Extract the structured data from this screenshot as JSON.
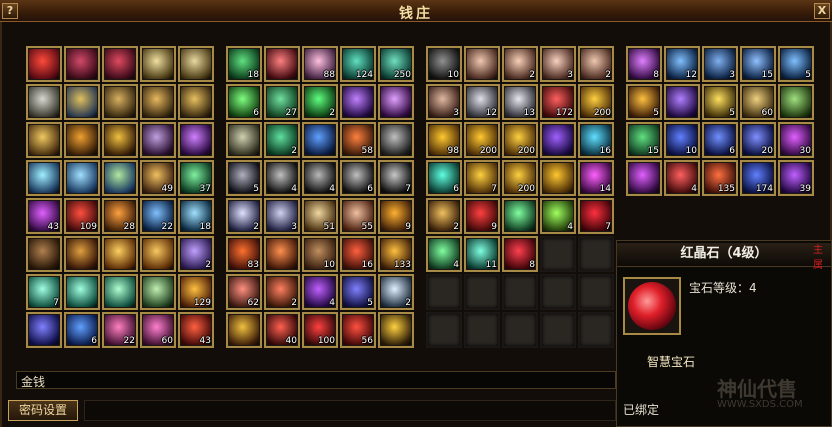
{
  "window": {
    "title": "钱庄",
    "help_label": "?",
    "close_label": "X"
  },
  "colors": {
    "frame_gold": "#a78a45",
    "title_text": "#f3dfa4",
    "gem_red": "#e0202a",
    "watermark_red": "#d02020"
  },
  "bags": [
    {
      "name": "bag-1",
      "slots": [
        {
          "icon": "red-feather-icon",
          "c1": "#ff4a3a",
          "c2": "#5a0a14"
        },
        {
          "icon": "crimson-wing-icon",
          "c1": "#d24a6a",
          "c2": "#3a0a18"
        },
        {
          "icon": "crimson-wing-icon",
          "c1": "#e04a60",
          "c2": "#3a0a18"
        },
        {
          "icon": "gold-ring-icon",
          "c1": "#f0e0a0",
          "c2": "#4a3a14"
        },
        {
          "icon": "gold-ring-icon",
          "c1": "#e8d8a0",
          "c2": "#4a3a14"
        },
        {
          "icon": "silver-ring-icon",
          "c1": "#d8d8d0",
          "c2": "#3a3a30"
        },
        {
          "icon": "armor-icon",
          "c1": "#e0c060",
          "c2": "#2a3a50"
        },
        {
          "icon": "armor-icon",
          "c1": "#d8b060",
          "c2": "#3a2a10"
        },
        {
          "icon": "armor-icon",
          "c1": "#e8b860",
          "c2": "#3a2a10"
        },
        {
          "icon": "armor-icon",
          "c1": "#e8c060",
          "c2": "#3a2a10"
        },
        {
          "icon": "gold-armor-icon",
          "c1": "#f0c860",
          "c2": "#4a3010"
        },
        {
          "icon": "gold-emblem-icon",
          "c1": "#f0a030",
          "c2": "#3a2008"
        },
        {
          "icon": "gold-bracelet-icon",
          "c1": "#f0c040",
          "c2": "#3a2008"
        },
        {
          "icon": "sword-icon",
          "c1": "#c0a0e0",
          "c2": "#2a1030"
        },
        {
          "icon": "purple-crystal-icon",
          "c1": "#d080ff",
          "c2": "#2a0a40"
        },
        {
          "icon": "spirit-icon",
          "c1": "#a0f0ff",
          "c2": "#1a3a60"
        },
        {
          "icon": "spirit-icon",
          "c1": "#a0e0ff",
          "c2": "#1a3a60"
        },
        {
          "icon": "spirit-icon",
          "c1": "#b0e8a0",
          "c2": "#1a3a60"
        },
        {
          "icon": "scroll-icon",
          "c1": "#f0c060",
          "c2": "#402410",
          "count": "49"
        },
        {
          "icon": "spirit-icon",
          "c1": "#80f0a0",
          "c2": "#0a3a20",
          "count": "37"
        },
        {
          "icon": "purple-seal-icon",
          "c1": "#e060ff",
          "c2": "#300a40",
          "count": "43"
        },
        {
          "icon": "red-seal-icon",
          "c1": "#ff5040",
          "c2": "#400a0a",
          "count": "109"
        },
        {
          "icon": "fire-seal-icon",
          "c1": "#ffa040",
          "c2": "#402008",
          "count": "28"
        },
        {
          "icon": "water-seal-icon",
          "c1": "#80c0ff",
          "c2": "#0a2040",
          "count": "22"
        },
        {
          "icon": "ice-seal-icon",
          "c1": "#a0e0ff",
          "c2": "#0a2a40",
          "count": "18"
        },
        {
          "icon": "brown-charm-icon",
          "c1": "#b08050",
          "c2": "#2a1808"
        },
        {
          "icon": "compass-icon",
          "c1": "#e0a040",
          "c2": "#3a1808"
        },
        {
          "icon": "gold-coin-icon",
          "c1": "#ffd060",
          "c2": "#603008"
        },
        {
          "icon": "gold-coin-icon",
          "c1": "#f8c860",
          "c2": "#603008"
        },
        {
          "icon": "jade-tablet-icon",
          "c1": "#c0a0ff",
          "c2": "#2a1a50",
          "count": "2"
        },
        {
          "icon": "jade-tablet-icon",
          "c1": "#a0ffe0",
          "c2": "#105040",
          "count": "7"
        },
        {
          "icon": "jade-tablet-icon",
          "c1": "#a0ffe0",
          "c2": "#105040"
        },
        {
          "icon": "jade-tablet-icon",
          "c1": "#b0ffd0",
          "c2": "#105040"
        },
        {
          "icon": "jade-tablet-icon",
          "c1": "#c0f0b0",
          "c2": "#204020"
        },
        {
          "icon": "fire-spell-icon",
          "c1": "#ffc040",
          "c2": "#502008",
          "count": "129"
        },
        {
          "icon": "blue-rune-icon",
          "c1": "#8080ff",
          "c2": "#10104a"
        },
        {
          "icon": "blue-rune-icon",
          "c1": "#60a0ff",
          "c2": "#0a1a4a",
          "count": "6"
        },
        {
          "icon": "jade-tablet-icon",
          "c1": "#ff80c0",
          "c2": "#401030",
          "count": "22"
        },
        {
          "icon": "jade-tablet-icon",
          "c1": "#ff80d0",
          "c2": "#401030",
          "count": "60"
        },
        {
          "icon": "flame-spell-icon",
          "c1": "#ff6040",
          "c2": "#400808",
          "count": "43"
        }
      ]
    },
    {
      "name": "bag-2",
      "slots": [
        {
          "icon": "green-jade-icon",
          "c1": "#60e080",
          "c2": "#0a3a1a",
          "count": "18"
        },
        {
          "icon": "red-crystal-icon",
          "c1": "#ff8080",
          "c2": "#400a10"
        },
        {
          "icon": "pink-gem-icon",
          "c1": "#ffc0e0",
          "c2": "#402040",
          "count": "88"
        },
        {
          "icon": "teal-relic-icon",
          "c1": "#60e0c0",
          "c2": "#0a3a30",
          "count": "124"
        },
        {
          "icon": "teal-relic-icon",
          "c1": "#70e0c0",
          "c2": "#0a3a30",
          "count": "250"
        },
        {
          "icon": "green-orb-icon",
          "c1": "#80ff80",
          "c2": "#104010",
          "count": "6"
        },
        {
          "icon": "green-orb-icon",
          "c1": "#70e0a0",
          "c2": "#104020",
          "count": "27"
        },
        {
          "icon": "green-shard-icon",
          "c1": "#60ff80",
          "c2": "#0a3a10",
          "count": "2"
        },
        {
          "icon": "purple-potion-icon",
          "c1": "#c080ff",
          "c2": "#200a40"
        },
        {
          "icon": "purple-potion-icon",
          "c1": "#e0a0ff",
          "c2": "#300a40"
        },
        {
          "icon": "stone-tablet-icon",
          "c1": "#d0d0b0",
          "c2": "#303020"
        },
        {
          "icon": "green-potion-icon",
          "c1": "#60e0a0",
          "c2": "#0a3a20",
          "count": "2"
        },
        {
          "icon": "blue-crystal-icon",
          "c1": "#60a0ff",
          "c2": "#0a1a40"
        },
        {
          "icon": "fruit-icon",
          "c1": "#ff8040",
          "c2": "#3a1a08",
          "count": "58"
        },
        {
          "icon": "ore-icon",
          "c1": "#c0c0c0",
          "c2": "#202020"
        },
        {
          "icon": "dark-ore-icon",
          "c1": "#b0b0c0",
          "c2": "#101018",
          "count": "5"
        },
        {
          "icon": "dark-ore-icon",
          "c1": "#c0c0c0",
          "c2": "#101010",
          "count": "4"
        },
        {
          "icon": "dark-ore-icon",
          "c1": "#b8b8b8",
          "c2": "#101010",
          "count": "4"
        },
        {
          "icon": "dark-ore-icon",
          "c1": "#c0c0c0",
          "c2": "#101010",
          "count": "6"
        },
        {
          "icon": "dark-ore-icon",
          "c1": "#c8c8c8",
          "c2": "#101010",
          "count": "7"
        },
        {
          "icon": "silver-dice-icon",
          "c1": "#e0e0ff",
          "c2": "#202040",
          "count": "2"
        },
        {
          "icon": "silver-dice-icon",
          "c1": "#d0d0f0",
          "c2": "#202040",
          "count": "3"
        },
        {
          "icon": "scroll-icon",
          "c1": "#f0d8a0",
          "c2": "#4a3010",
          "count": "51"
        },
        {
          "icon": "scroll-icon",
          "c1": "#f0c0a0",
          "c2": "#4a2010",
          "count": "55"
        },
        {
          "icon": "gold-dragon-icon",
          "c1": "#ffb030",
          "c2": "#402008",
          "count": "9"
        },
        {
          "icon": "fire-dragon-icon",
          "c1": "#ff7030",
          "c2": "#401008",
          "count": "83"
        },
        {
          "icon": "bow-icon",
          "c1": "#ff9050",
          "c2": "#401808"
        },
        {
          "icon": "wood-plank-icon",
          "c1": "#c09060",
          "c2": "#3a2010",
          "count": "10"
        },
        {
          "icon": "firecracker-icon",
          "c1": "#ff6040",
          "c2": "#401008",
          "count": "16"
        },
        {
          "icon": "gold-scroll-icon",
          "c1": "#ffc040",
          "c2": "#402008",
          "count": "133"
        },
        {
          "icon": "jade-disc-icon",
          "c1": "#ff9080",
          "c2": "#3a1810",
          "count": "62"
        },
        {
          "icon": "jade-disc-icon",
          "c1": "#ff8060",
          "c2": "#3a1808",
          "count": "2"
        },
        {
          "icon": "purple-orb-icon",
          "c1": "#c060ff",
          "c2": "#200840",
          "count": "4"
        },
        {
          "icon": "blue-sphere-icon",
          "c1": "#8080ff",
          "c2": "#101040",
          "count": "5"
        },
        {
          "icon": "white-orb-icon",
          "c1": "#e0f0ff",
          "c2": "#203040",
          "count": "2"
        },
        {
          "icon": "birdcage-icon",
          "c1": "#f0c040",
          "c2": "#402008"
        },
        {
          "icon": "bomb-icon",
          "c1": "#ff6050",
          "c2": "#300808",
          "count": "40"
        },
        {
          "icon": "lantern-icon",
          "c1": "#ff4040",
          "c2": "#300808",
          "count": "100"
        },
        {
          "icon": "red-jar-icon",
          "c1": "#ff5040",
          "c2": "#400808",
          "count": "56"
        },
        {
          "icon": "golden-spear-icon",
          "c1": "#ffd040",
          "c2": "#302008"
        }
      ]
    },
    {
      "name": "bag-3",
      "slots": [
        {
          "icon": "coal-icon",
          "c1": "#909090",
          "c2": "#101010",
          "count": "10"
        },
        {
          "icon": "copper-ingot-icon",
          "c1": "#f0c8b0",
          "c2": "#4a2a20"
        },
        {
          "icon": "copper-ingot-icon",
          "c1": "#f8d0b8",
          "c2": "#4a2a20",
          "count": "2"
        },
        {
          "icon": "copper-ingot-icon",
          "c1": "#f8d0c0",
          "c2": "#4a2a20",
          "count": "3"
        },
        {
          "icon": "copper-ingot-icon",
          "c1": "#f0c8b0",
          "c2": "#4a2a20",
          "count": "2"
        },
        {
          "icon": "copper-ore-icon",
          "c1": "#e0b8a0",
          "c2": "#3a2018",
          "count": "3"
        },
        {
          "icon": "silver-ore-icon",
          "c1": "#e0e0e8",
          "c2": "#303038",
          "count": "12"
        },
        {
          "icon": "silver-ore-icon",
          "c1": "#e8e8f0",
          "c2": "#303038",
          "count": "13"
        },
        {
          "icon": "red-potion-icon",
          "c1": "#ff6060",
          "c2": "#400a0a",
          "count": "172"
        },
        {
          "icon": "gold-ingot-icon",
          "c1": "#ffd040",
          "c2": "#503008",
          "count": "200"
        },
        {
          "icon": "gold-ingot-icon",
          "c1": "#ffc830",
          "c2": "#503008",
          "count": "98"
        },
        {
          "icon": "gold-ingot-icon",
          "c1": "#ffc830",
          "c2": "#503008",
          "count": "200"
        },
        {
          "icon": "gold-ingot-icon",
          "c1": "#ffd040",
          "c2": "#503008",
          "count": "200"
        },
        {
          "icon": "violet-crystal-icon",
          "c1": "#a060ff",
          "c2": "#1a0a40"
        },
        {
          "icon": "ice-orb-icon",
          "c1": "#60e0ff",
          "c2": "#0a3040",
          "count": "16"
        },
        {
          "icon": "cyan-gem-icon",
          "c1": "#60ffe0",
          "c2": "#0a3a30",
          "count": "6"
        },
        {
          "icon": "gold-bar-icon",
          "c1": "#ffd040",
          "c2": "#503008",
          "count": "7"
        },
        {
          "icon": "gold-bar-icon",
          "c1": "#ffd040",
          "c2": "#503008",
          "count": "200"
        },
        {
          "icon": "gold-bar-icon",
          "c1": "#ffc830",
          "c2": "#503008"
        },
        {
          "icon": "pink-gem-icon",
          "c1": "#ff60ff",
          "c2": "#3a0a40",
          "count": "14"
        },
        {
          "icon": "straw-hat-icon",
          "c1": "#f0c060",
          "c2": "#3a2008",
          "count": "2"
        },
        {
          "icon": "red-crystal-icon",
          "c1": "#ff4040",
          "c2": "#400808",
          "count": "9"
        },
        {
          "icon": "green-gem-icon",
          "c1": "#80ffa0",
          "c2": "#103a20"
        },
        {
          "icon": "green-gem-icon",
          "c1": "#a0ff60",
          "c2": "#203a08",
          "count": "4"
        },
        {
          "icon": "red-gem-icon",
          "c1": "#ff3040",
          "c2": "#400408",
          "count": "7"
        },
        {
          "icon": "green-gem-icon",
          "c1": "#80ffa0",
          "c2": "#103a20",
          "count": "4"
        },
        {
          "icon": "teal-gem-icon",
          "c1": "#80ffe0",
          "c2": "#0a3a30",
          "count": "11"
        },
        {
          "icon": "red-gem-icon",
          "c1": "#ff4050",
          "c2": "#400408",
          "count": "8"
        },
        {
          "icon": "empty-slot-icon",
          "empty": true
        },
        {
          "icon": "empty-slot-icon",
          "empty": true
        },
        {
          "icon": "empty-slot-icon",
          "empty": true
        },
        {
          "icon": "empty-slot-icon",
          "empty": true
        },
        {
          "icon": "empty-slot-icon",
          "empty": true
        },
        {
          "icon": "empty-slot-icon",
          "empty": true
        },
        {
          "icon": "empty-slot-icon",
          "empty": true
        },
        {
          "icon": "empty-slot-icon",
          "empty": true
        },
        {
          "icon": "empty-slot-icon",
          "empty": true
        },
        {
          "icon": "empty-slot-icon",
          "empty": true
        },
        {
          "icon": "empty-slot-icon",
          "empty": true
        },
        {
          "icon": "empty-slot-icon",
          "empty": true
        }
      ]
    },
    {
      "name": "bag-4",
      "slots": [
        {
          "icon": "purple-vase-icon",
          "c1": "#e080ff",
          "c2": "#300a40",
          "count": "8"
        },
        {
          "icon": "blue-vase-icon",
          "c1": "#80c0ff",
          "c2": "#0a2040",
          "count": "12"
        },
        {
          "icon": "blue-vase-icon",
          "c1": "#80b0f0",
          "c2": "#0a2040",
          "count": "3"
        },
        {
          "icon": "blue-vase-icon",
          "c1": "#90c0ff",
          "c2": "#0a2040",
          "count": "15"
        },
        {
          "icon": "blue-vase-icon",
          "c1": "#80c0ff",
          "c2": "#0a2040",
          "count": "5"
        },
        {
          "icon": "gold-orb-icon",
          "c1": "#ffc040",
          "c2": "#402008",
          "count": "5"
        },
        {
          "icon": "purple-book-icon",
          "c1": "#b080ff",
          "c2": "#200a40"
        },
        {
          "icon": "gold-book-icon",
          "c1": "#ffe060",
          "c2": "#403008",
          "count": "5"
        },
        {
          "icon": "scroll-icon",
          "c1": "#f0d080",
          "c2": "#403010",
          "count": "60"
        },
        {
          "icon": "green-book-icon",
          "c1": "#a0e080",
          "c2": "#203a10"
        },
        {
          "icon": "green-book-icon",
          "c1": "#60e080",
          "c2": "#103a20",
          "count": "15"
        },
        {
          "icon": "blue-vase-icon",
          "c1": "#6080ff",
          "c2": "#0a1040",
          "count": "10"
        },
        {
          "icon": "blue-vase-icon",
          "c1": "#7090ff",
          "c2": "#0a1040",
          "count": "6"
        },
        {
          "icon": "blue-vase-icon",
          "c1": "#8090ff",
          "c2": "#0a1040",
          "count": "20"
        },
        {
          "icon": "purple-vase-icon",
          "c1": "#e060ff",
          "c2": "#300a40",
          "count": "30"
        },
        {
          "icon": "purple-potion-icon",
          "c1": "#e060ff",
          "c2": "#300a40"
        },
        {
          "icon": "red-potion-icon",
          "c1": "#ff6060",
          "c2": "#400a0a",
          "count": "4"
        },
        {
          "icon": "red-potion-icon",
          "c1": "#ff7040",
          "c2": "#401008",
          "count": "135"
        },
        {
          "icon": "blue-potion-icon",
          "c1": "#6080ff",
          "c2": "#0a1040",
          "count": "174"
        },
        {
          "icon": "purple-potion-icon",
          "c1": "#c060ff",
          "c2": "#200840",
          "count": "39"
        }
      ]
    }
  ],
  "gold_label": "金钱",
  "password_button": "密码设置",
  "detail": {
    "title": "红晶石（4级）",
    "gem_level": "宝石等级：4",
    "gem_type": "智慧宝石",
    "bound": "已绑定",
    "red_text": "主属"
  },
  "watermark": {
    "site": "神仙代售",
    "url": "WWW.SXDS.COM"
  }
}
